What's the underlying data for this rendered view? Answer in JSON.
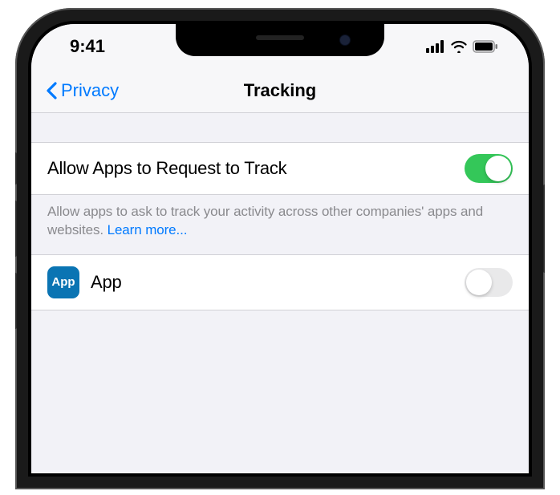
{
  "status": {
    "time": "9:41"
  },
  "nav": {
    "back_label": "Privacy",
    "title": "Tracking"
  },
  "main_toggle": {
    "label": "Allow Apps to Request to Track"
  },
  "footer": {
    "text": "Allow apps to ask to track your activity across other companies' apps and websites. ",
    "link": "Learn more..."
  },
  "apps": [
    {
      "icon_label": "App",
      "name": "App"
    }
  ]
}
